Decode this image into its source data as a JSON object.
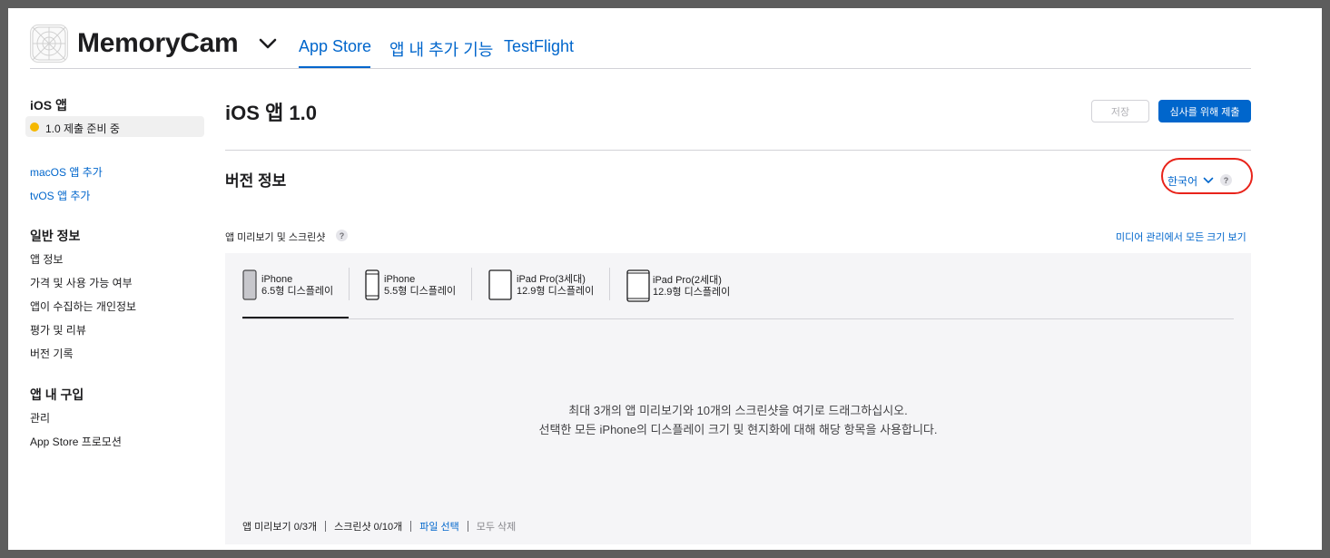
{
  "header": {
    "app_name": "MemoryCam",
    "tabs": [
      "App Store",
      "앱 내 추가 기능",
      "TestFlight"
    ]
  },
  "sidebar": {
    "ios_heading": "iOS 앱",
    "status": "1.0 제출 준비 중",
    "add_macos": "macOS 앱 추가",
    "add_tvos": "tvOS 앱 추가",
    "general_heading": "일반 정보",
    "general_items": [
      "앱 정보",
      "가격 및 사용 가능 여부",
      "앱이 수집하는 개인정보",
      "평가 및 리뷰",
      "버전 기록"
    ],
    "iap_heading": "앱 내 구입",
    "iap_items": [
      "관리",
      "App Store 프로모션"
    ]
  },
  "main": {
    "title": "iOS 앱 1.0",
    "save_label": "저장",
    "submit_label": "심사를 위해 제출",
    "section_title": "버전 정보",
    "language": "한국어",
    "help_glyph": "?",
    "preview_label": "앱 미리보기 및 스크린샷",
    "media_link": "미디어 관리에서 모든 크기 보기",
    "devices": [
      {
        "name": "iPhone",
        "size": "6.5형 디스플레이"
      },
      {
        "name": "iPhone",
        "size": "5.5형 디스플레이"
      },
      {
        "name": "iPad Pro(3세대)",
        "size": "12.9형 디스플레이"
      },
      {
        "name": "iPad Pro(2세대)",
        "size": "12.9형 디스플레이"
      }
    ],
    "drop_line1": "최대 3개의 앱 미리보기와 10개의 스크린샷을 여기로 드래그하십시오.",
    "drop_line2": "선택한 모든 iPhone의 디스플레이 크기 및 현지화에 대해 해당 항목을 사용합니다.",
    "footer": {
      "preview_count": "앱 미리보기 0/3개",
      "screenshot_count": "스크린샷 0/10개",
      "choose_file": "파일 선택",
      "delete_all": "모두 삭제"
    }
  },
  "colors": {
    "accent": "#0066cc",
    "status_dot": "#f5b800",
    "highlight": "#e8231a"
  }
}
